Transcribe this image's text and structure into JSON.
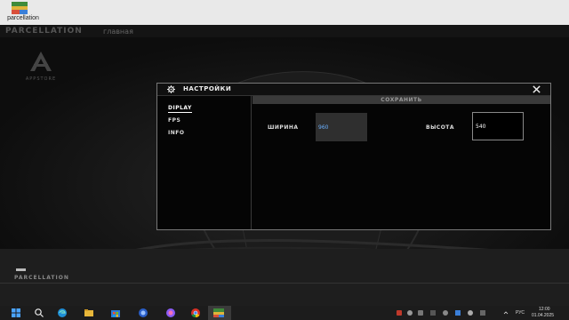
{
  "desktop": {
    "icon_label": "parcellation"
  },
  "app": {
    "title": "PARCELLATION",
    "subtitle": "главная",
    "appstore_label": "APPSTORE",
    "bottom_label": "PARCELLATION"
  },
  "dialog": {
    "title": "НАСТРОЙКИ",
    "tabs": [
      {
        "label": "DIPLAY",
        "active": true
      },
      {
        "label": "FPS",
        "active": false
      },
      {
        "label": "INFO",
        "active": false
      }
    ],
    "save_label": "СОХРАНИТЬ",
    "width_label": "ШИРИНА",
    "width_value": "960",
    "height_label": "ВЫСОТА",
    "height_value": "540"
  },
  "taskbar": {
    "lang": "РУС",
    "time": "12:00",
    "date": "01.04.2025"
  },
  "colors": {
    "dialog_bg": "#050505",
    "accent_blue": "#6ab0ff",
    "save_bar": "#3a3a3a"
  }
}
